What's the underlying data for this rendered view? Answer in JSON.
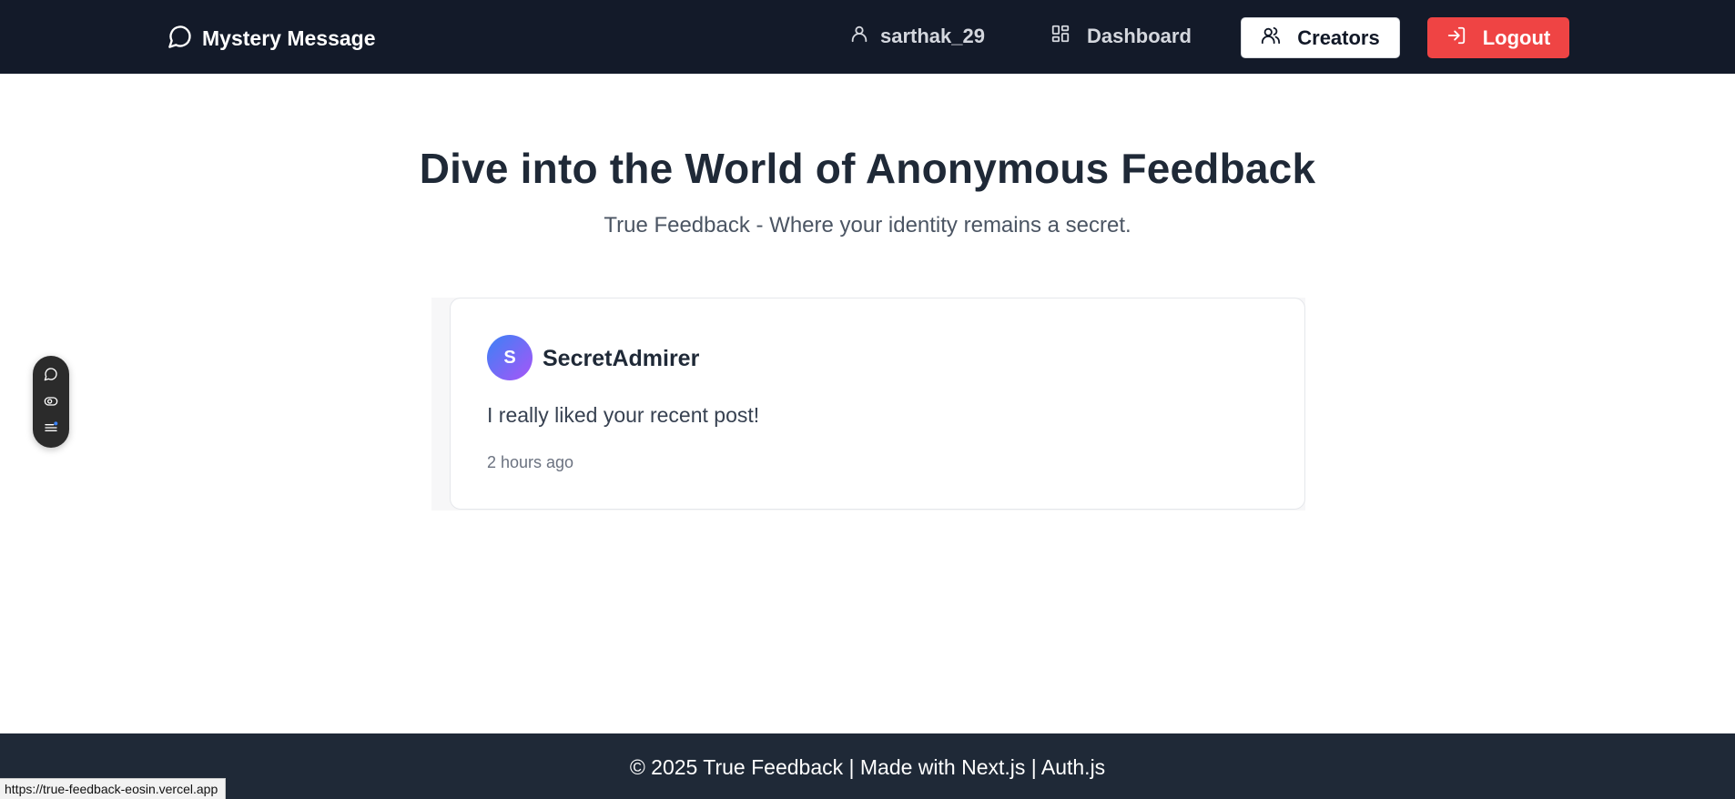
{
  "navbar": {
    "brand": "Mystery Message",
    "username": "sarthak_29",
    "dashboard_label": "Dashboard",
    "creators_label": "Creators",
    "logout_label": "Logout"
  },
  "hero": {
    "title": "Dive into the World of Anonymous Feedback",
    "subtitle": "True Feedback - Where your identity remains a secret."
  },
  "message_card": {
    "avatar_initial": "S",
    "sender": "SecretAdmirer",
    "text": "I really liked your recent post!",
    "time": "2 hours ago"
  },
  "footer": {
    "text": "© 2025 True Feedback | Made with Next.js | Auth.js"
  },
  "status_bar": {
    "url": "https://true-feedback-eosin.vercel.app"
  },
  "icons": {
    "brand": "message-circle-icon",
    "user": "user-icon",
    "dashboard": "layout-grid-icon",
    "creators": "users-icon",
    "logout": "log-out-icon"
  },
  "colors": {
    "navbar_bg": "#131a29",
    "logout_bg": "#ef4444",
    "footer_bg": "#1f2937",
    "title": "#1f2937"
  }
}
